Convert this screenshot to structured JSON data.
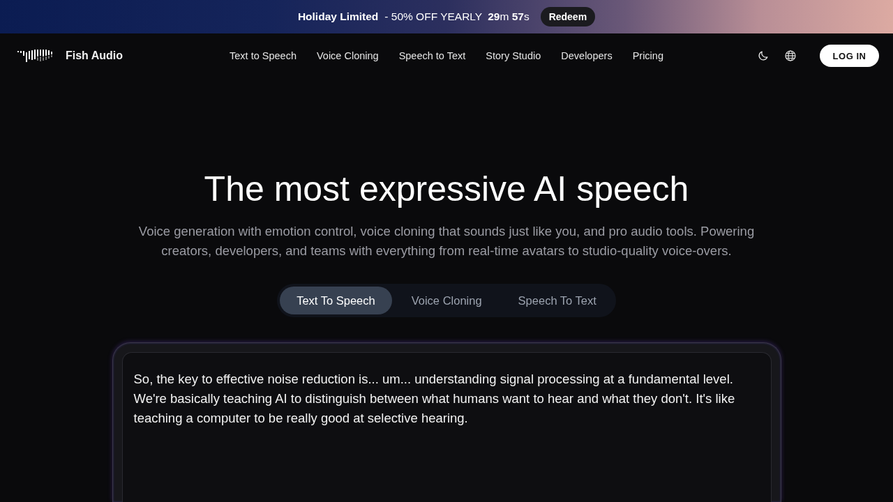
{
  "banner": {
    "headline": "Holiday Limited",
    "offer": "- 50% OFF YEARLY",
    "countdown": "**29**m **57**s",
    "button": "Redeem"
  },
  "header": {
    "brand": "Fish Audio",
    "nav": [
      {
        "label": "Text to Speech"
      },
      {
        "label": "Voice Cloning"
      },
      {
        "label": "Speech to Text"
      },
      {
        "label": "Story Studio"
      },
      {
        "label": "Developers"
      },
      {
        "label": "Pricing"
      }
    ],
    "login_button": "LOG IN"
  },
  "hero": {
    "title": "The most expressive AI speech",
    "subtitle": "Voice generation with emotion control, voice cloning that sounds just like you, and pro audio tools. Powering creators, developers, and teams with everything from real-time avatars to studio-quality voice-overs."
  },
  "mode_tabs": [
    {
      "label": "Text To Speech",
      "selected": true
    },
    {
      "label": "Voice Cloning",
      "selected": false
    },
    {
      "label": "Speech To Text",
      "selected": false
    }
  ],
  "editor": {
    "value": "So, the key to effective noise reduction is... um... understanding signal processing at a fundamental level. We're basically teaching AI to distinguish between what humans want to hear and what they don't. It's like teaching a computer to be really good at selective hearing."
  }
}
